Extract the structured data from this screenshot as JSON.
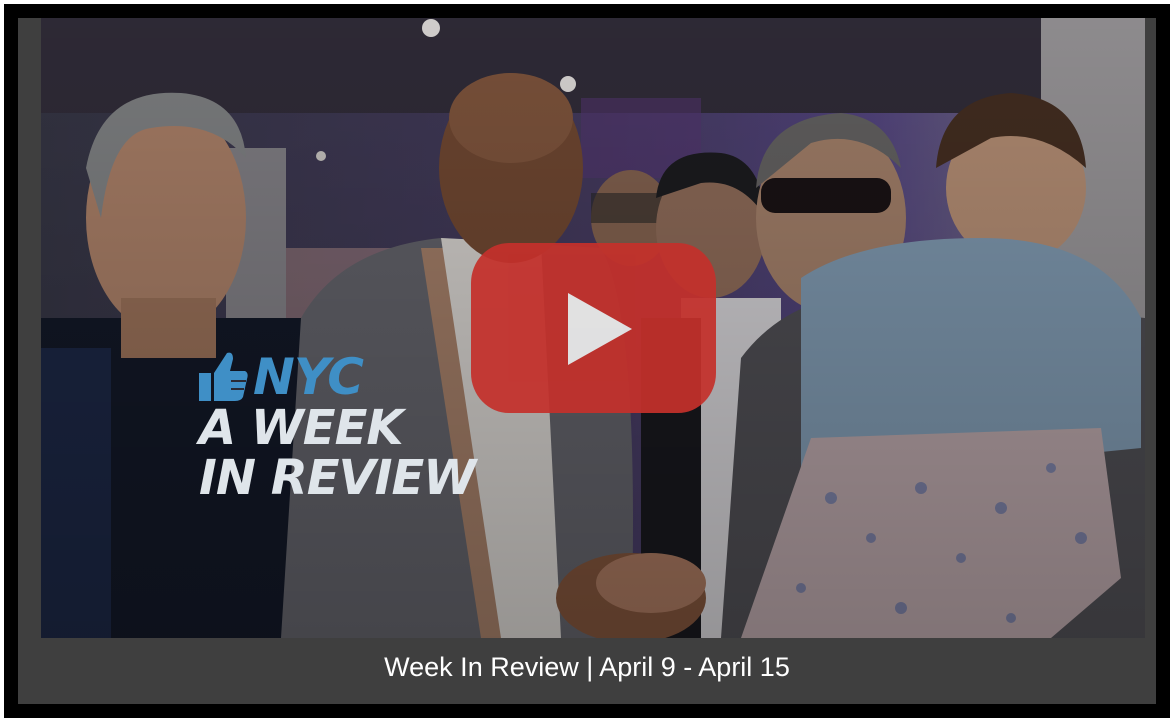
{
  "video": {
    "thumbnail_description_icon": "video-thumbnail",
    "play_icon": "play-icon",
    "brand": {
      "logo_icon": "thumbs-up-icon",
      "logo_text": "NYC",
      "title_line1": "A WEEK",
      "title_line2": "IN REVIEW"
    }
  },
  "caption": {
    "text": "Week In Review | April 9 - April 15"
  },
  "colors": {
    "frame": "#000000",
    "card": "#3f3f3f",
    "play_button": "#c4302b",
    "brand_blue": "#3f8fc6",
    "brand_light": "#dfe5ea"
  }
}
